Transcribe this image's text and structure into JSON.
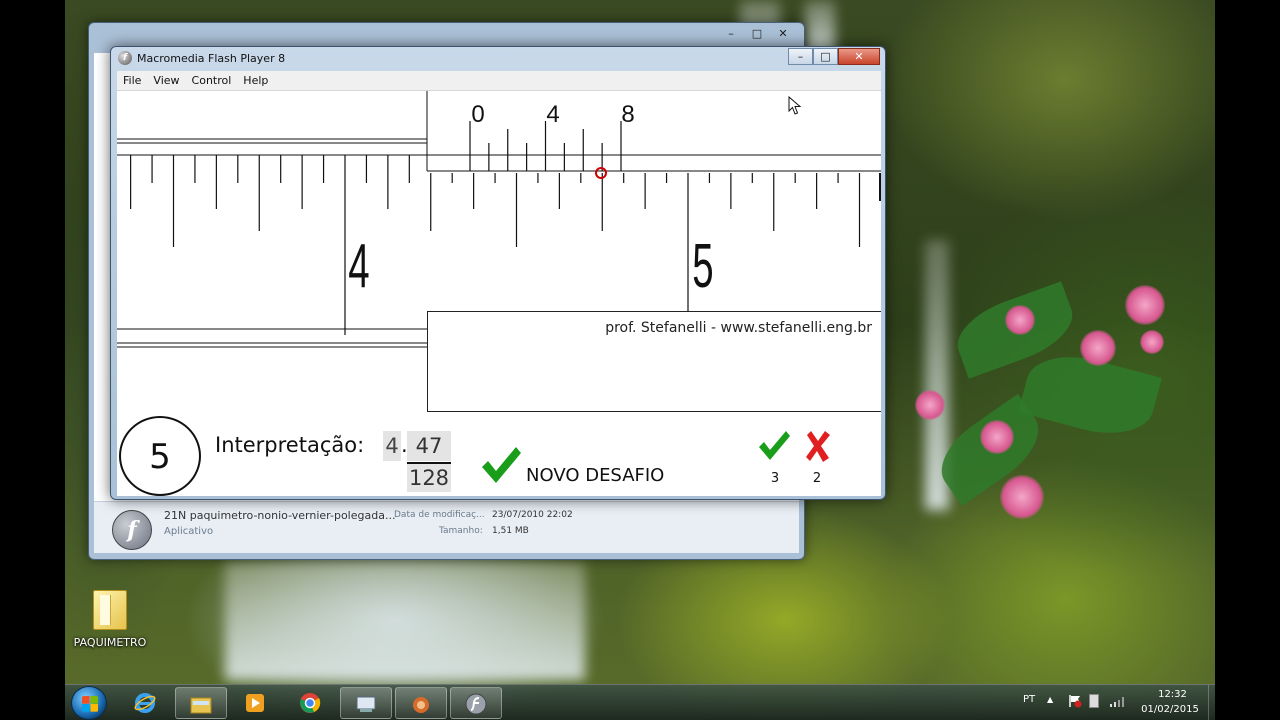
{
  "flash_window": {
    "title": "Macromedia Flash Player 8",
    "menu": [
      "File",
      "View",
      "Control",
      "Help"
    ],
    "controls": {
      "minimize": "–",
      "maximize": "□",
      "close": "✕"
    }
  },
  "caliper": {
    "vernier_labels": [
      "0",
      "4",
      "8"
    ],
    "main_labels": [
      "4",
      "5"
    ],
    "credit": "prof. Stefanelli - www.stefanelli.eng.br"
  },
  "challenge": {
    "score": "5",
    "label": "Interpretação:",
    "whole": "4",
    "dot": ".",
    "numerator": "47",
    "denominator": "128",
    "new_challenge": "NOVO DESAFIO",
    "correct_count": "3",
    "wrong_count": "2"
  },
  "explorer": {
    "controls": {
      "minimize": "–",
      "maximize": "□",
      "close": "✕"
    },
    "file_name": "21N paquimetro-nonio-vernier-polegada...",
    "file_type": "Aplicativo",
    "modified_label": "Data de modificaç...",
    "modified_value": "23/07/2010 22:02",
    "size_label": "Tamanho:",
    "size_value": "1,51 MB"
  },
  "desktop": {
    "folder_label": "PAQUIMETRO"
  },
  "taskbar": {
    "apps": [
      "internet-explorer-icon",
      "file-explorer-icon",
      "media-player-icon",
      "chrome-icon",
      "network-app-icon",
      "game-app-icon",
      "flash-player-icon"
    ],
    "lang": "PT",
    "time": "12:32",
    "date": "01/02/2015"
  },
  "colors": {
    "check_green": "#1a9e1a",
    "x_red": "#e02020",
    "vernier_marker": "#cc0000"
  }
}
